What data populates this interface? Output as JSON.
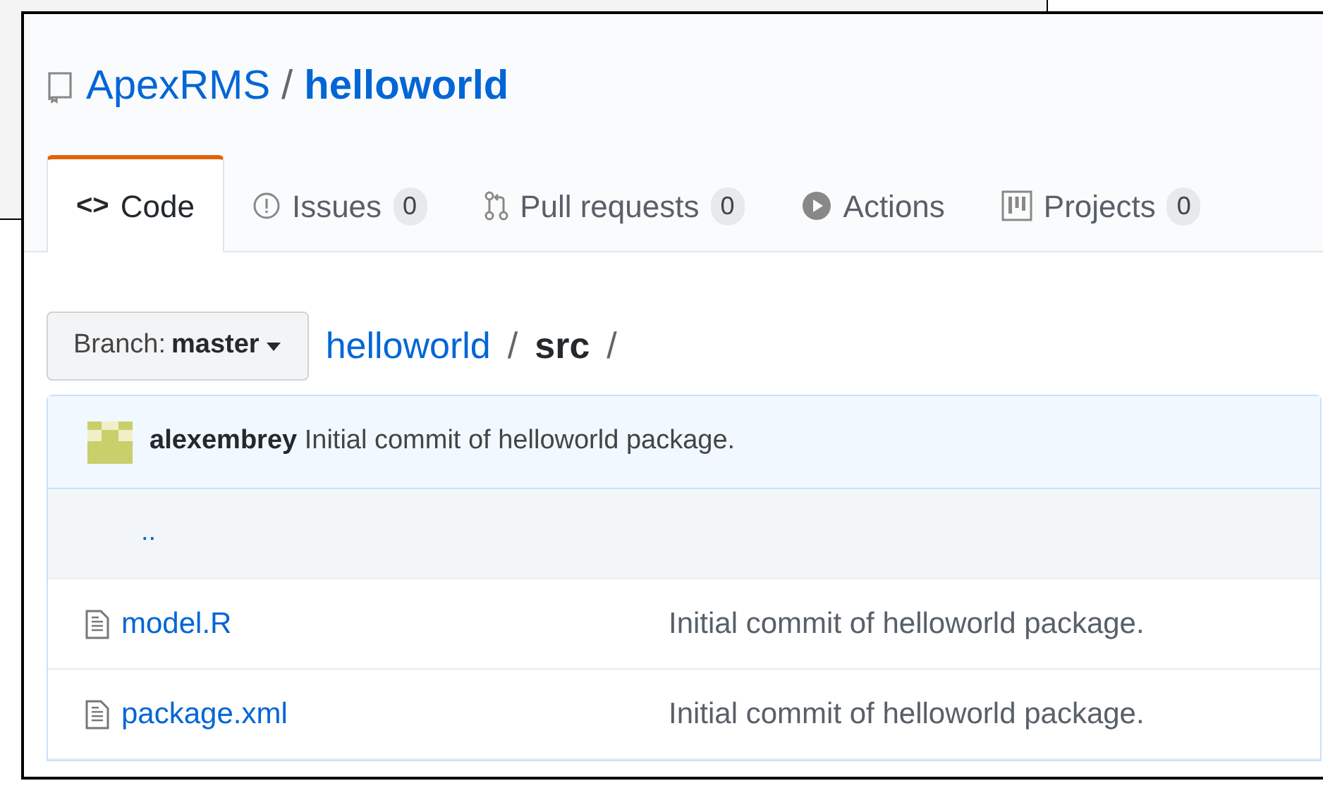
{
  "repo": {
    "owner": "ApexRMS",
    "separator": "/",
    "name": "helloworld"
  },
  "tabs": [
    {
      "kind": "code",
      "icon": "<>",
      "label": "Code",
      "selected": true
    },
    {
      "kind": "issues",
      "label": "Issues",
      "count": "0",
      "selected": false
    },
    {
      "kind": "pulls",
      "label": "Pull requests",
      "count": "0",
      "selected": false
    },
    {
      "kind": "actions",
      "label": "Actions",
      "selected": false
    },
    {
      "kind": "projects",
      "label": "Projects",
      "count": "0",
      "selected": false
    }
  ],
  "branch": {
    "label": "Branch:",
    "value": "master"
  },
  "breadcrumb": {
    "root": "helloworld",
    "sep1": "/",
    "folder": "src",
    "sep2": "/"
  },
  "commit": {
    "author": "alexembrey",
    "message": "Initial commit of helloworld package."
  },
  "files": [
    {
      "kind": "up",
      "name": ".."
    },
    {
      "kind": "file",
      "name": "model.R",
      "message": "Initial commit of helloworld package."
    },
    {
      "kind": "file",
      "name": "package.xml",
      "message": "Initial commit of helloworld package."
    }
  ]
}
